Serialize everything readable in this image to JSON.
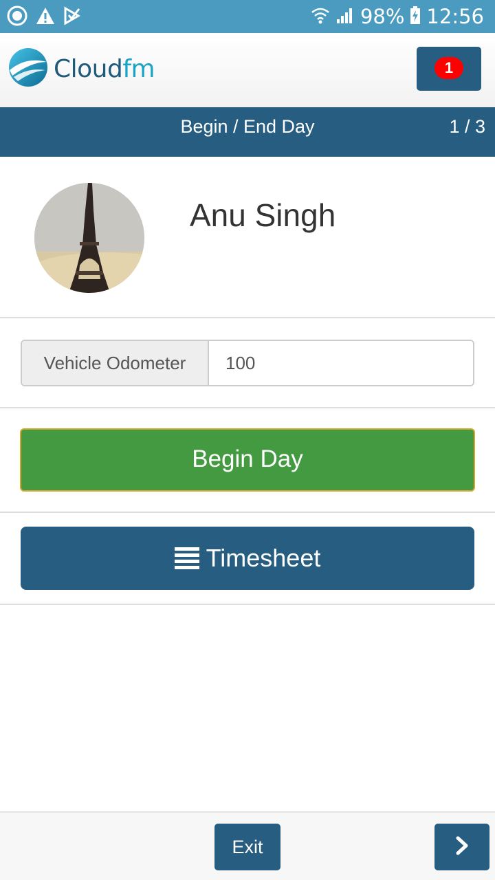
{
  "status_bar": {
    "battery": "98%",
    "time": "12:56",
    "icons": [
      "record-icon",
      "warning-icon",
      "checkbox-icon",
      "wifi-icon",
      "signal-icon",
      "battery-charging-icon"
    ]
  },
  "header": {
    "logo_text_main": "Cloud",
    "logo_text_accent": "fm",
    "notification_count": "1"
  },
  "title_bar": {
    "title": "Begin / End Day",
    "page": "1 / 3"
  },
  "profile": {
    "name": "Anu Singh"
  },
  "odometer": {
    "label": "Vehicle Odometer",
    "value": "100"
  },
  "actions": {
    "begin_day_label": "Begin Day",
    "timesheet_label": "Timesheet"
  },
  "footer": {
    "exit_label": "Exit",
    "next_icon": "chevron-right-icon"
  },
  "colors": {
    "status_bar": "#4b9bc0",
    "brand_blue": "#265d80",
    "begin_green": "#439a41",
    "badge_red": "#ff0000",
    "logo_teal": "#1ba3c6"
  }
}
